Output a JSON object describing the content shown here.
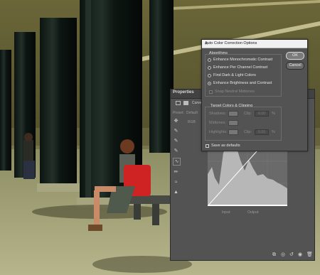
{
  "dialog": {
    "title": "Auto Color Correction Options",
    "close_icon": "close-icon",
    "algorithms": {
      "label": "Algorithms",
      "options": [
        {
          "label": "Enhance Monochromatic Contrast",
          "selected": false
        },
        {
          "label": "Enhance Per Channel Contrast",
          "selected": false
        },
        {
          "label": "Find Dark & Light Colors",
          "selected": false
        },
        {
          "label": "Enhance Brightness and Contrast",
          "selected": true
        }
      ],
      "snap_label": "Snap Neutral Midtones",
      "snap_checked": false
    },
    "targets": {
      "label": "Target Colors & Clipping",
      "shadows": {
        "label": "Shadows:",
        "clip_label": "Clip:",
        "clip_value": "0.10",
        "unit": "%"
      },
      "midtones": {
        "label": "Midtones:"
      },
      "highlights": {
        "label": "Highlights:",
        "clip_label": "Clip:",
        "clip_value": "0.10",
        "unit": "%"
      }
    },
    "save_defaults_label": "Save as defaults",
    "ok_label": "OK",
    "cancel_label": "Cancel"
  },
  "properties": {
    "title": "Properties",
    "panel_label": "Curves",
    "preset_label": "Preset:",
    "preset_value": "Default",
    "channel_value": "RGB",
    "input_label": "Input:",
    "output_label": "Output:",
    "tools": [
      "on-image-adjust-icon",
      "black-point-eyedropper-icon",
      "gray-point-eyedropper-icon",
      "white-point-eyedropper-icon",
      "curve-points-icon",
      "pencil-icon",
      "smooth-icon",
      "clipping-icon"
    ],
    "footer_icons": [
      "clip-to-layer-icon",
      "view-previous-icon",
      "reset-icon",
      "visibility-icon",
      "delete-icon"
    ]
  }
}
